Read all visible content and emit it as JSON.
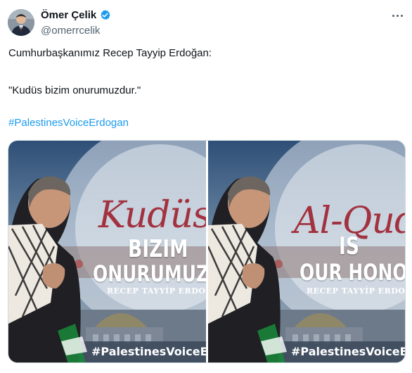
{
  "author": {
    "name": "Ömer Çelik",
    "handle": "@omerrcelik",
    "verified_color": "#1d9bf0"
  },
  "tweet": {
    "line1": "Cumhurbaşkanımız Recep Tayyip Erdoğan:",
    "line2": "\"Kudüs bizim onurumuzdur.\"",
    "hashtag": "#PalestinesVoiceErdogan"
  },
  "media": {
    "left": {
      "script_word": "Kudüs",
      "line1": "BIZIM",
      "line2": "ONURUMUZDUR",
      "signature": "RECEP TAYYİP ERDOĞAN",
      "hashtag": "#PalestinesVoiceErdogan"
    },
    "right": {
      "script_word": "Al-Quds",
      "line1": "IS",
      "line2": "OUR HONOUR",
      "signature": "RECEP TAYYİP ERDOĞAN",
      "hashtag": "#PalestinesVoiceErdogan"
    }
  },
  "icons": [
    "verified-badge-icon",
    "more-options-icon"
  ],
  "colors": {
    "text": "#0f1419",
    "secondary": "#536471",
    "link": "#1d9bf0",
    "accent_script": "#a2323f"
  }
}
